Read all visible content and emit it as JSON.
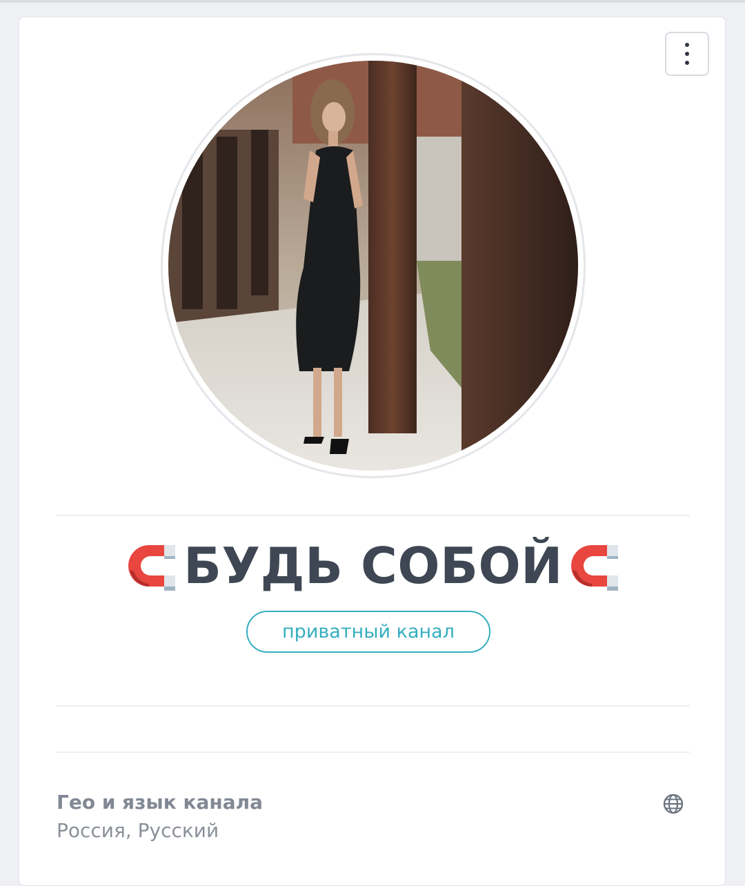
{
  "channel": {
    "title": "БУДЬ СОБОЙ",
    "title_icon": "magnet-icon",
    "badge": "приватный канал"
  },
  "menu": {
    "icon": "more-vertical-icon"
  },
  "geo": {
    "title": "Гео и язык канала",
    "value": "Россия, Русский",
    "icon": "globe-icon"
  },
  "colors": {
    "badge": "#35aebf",
    "title": "#3e4753",
    "magnet_red": "#e8463f",
    "magnet_tip": "#b8c7d2"
  }
}
